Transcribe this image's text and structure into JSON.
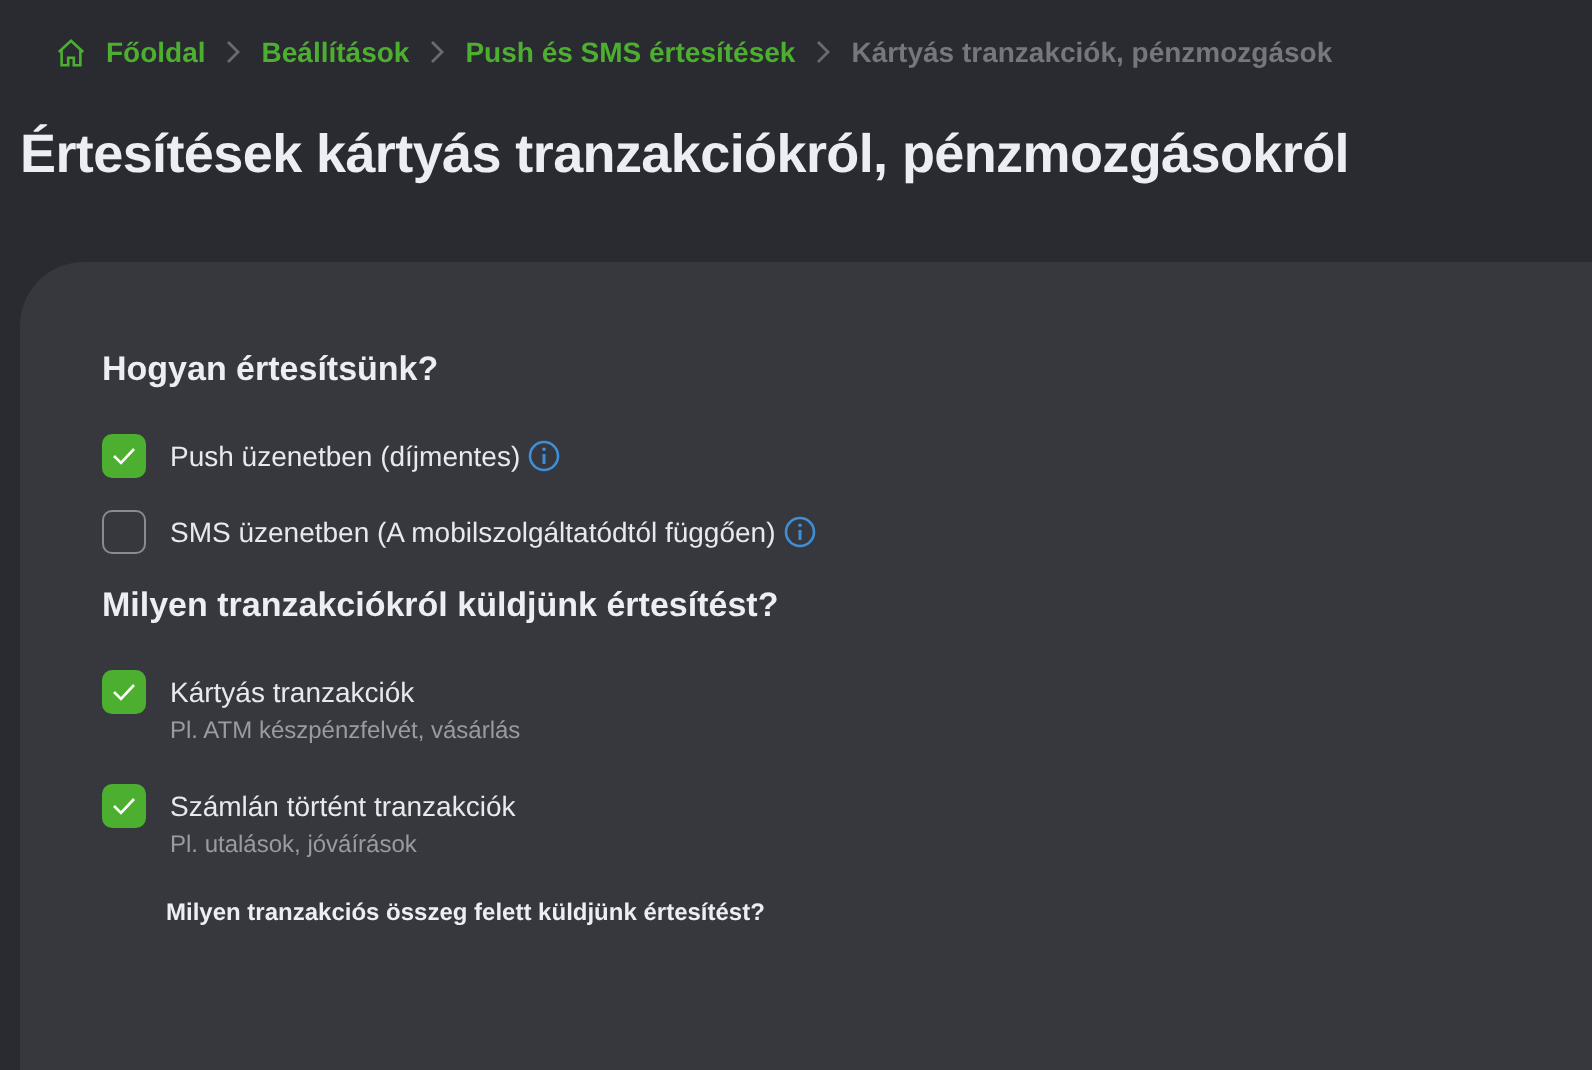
{
  "breadcrumb": [
    {
      "label": "Főoldal",
      "kind": "home",
      "current": false
    },
    {
      "label": "Beállítások",
      "kind": "link",
      "current": false
    },
    {
      "label": "Push és SMS értesítések",
      "kind": "link",
      "current": false
    },
    {
      "label": "Kártyás tranzakciók, pénzmozgások",
      "kind": "link",
      "current": true
    }
  ],
  "title": "Értesítések kártyás tranzakciókról, pénzmozgásokról",
  "sections": [
    {
      "heading": "Hogyan értesítsünk?",
      "options": [
        {
          "label": "Push üzenetben (díjmentes)",
          "checked": true,
          "info": true
        },
        {
          "label": "SMS üzenetben (A mobilszolgáltatódtól függően)",
          "checked": false,
          "info": true
        }
      ]
    },
    {
      "heading": "Milyen tranzakciókról küldjünk értesítést?",
      "options": [
        {
          "label": "Kártyás tranzakciók",
          "hint": "Pl. ATM készpénzfelvét, vásárlás",
          "checked": true,
          "info": false
        },
        {
          "label": "Számlán történt tranzakciók",
          "hint": "Pl. utalások, jóváírások",
          "checked": true,
          "info": false
        }
      ]
    }
  ],
  "amount_question": "Milyen tranzakciós összeg felett küldjünk értesítést?"
}
